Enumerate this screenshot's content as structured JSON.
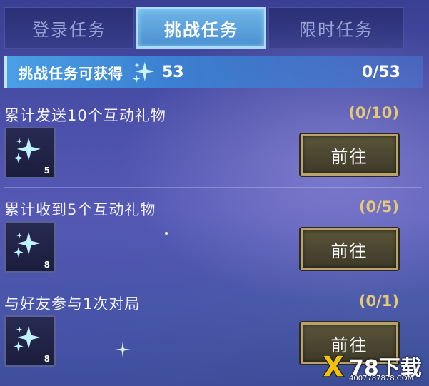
{
  "tabs": [
    {
      "label": "登录任务"
    },
    {
      "label": "挑战任务"
    },
    {
      "label": "限时任务"
    }
  ],
  "banner": {
    "title": "挑战任务可获得",
    "value": "53",
    "progress": "0/53",
    "icon": "sparkle-star-icon"
  },
  "tasks": [
    {
      "title": "累计发送10个互动礼物",
      "progress": "(0/10)",
      "reward_count": "5",
      "button": "前往"
    },
    {
      "title": "累计收到5个互动礼物",
      "progress": "(0/5)",
      "reward_count": "8",
      "button": "前往"
    },
    {
      "title": "与好友参与1次对局",
      "progress": "(0/1)",
      "reward_count": "8",
      "button": "前往"
    }
  ],
  "watermark": {
    "text": "78下载",
    "url": "4007787878.COM"
  },
  "colors": {
    "accent_blue": "#4a9fe6",
    "progress_gold": "#e6c977",
    "button_border": "#b9a36a"
  }
}
